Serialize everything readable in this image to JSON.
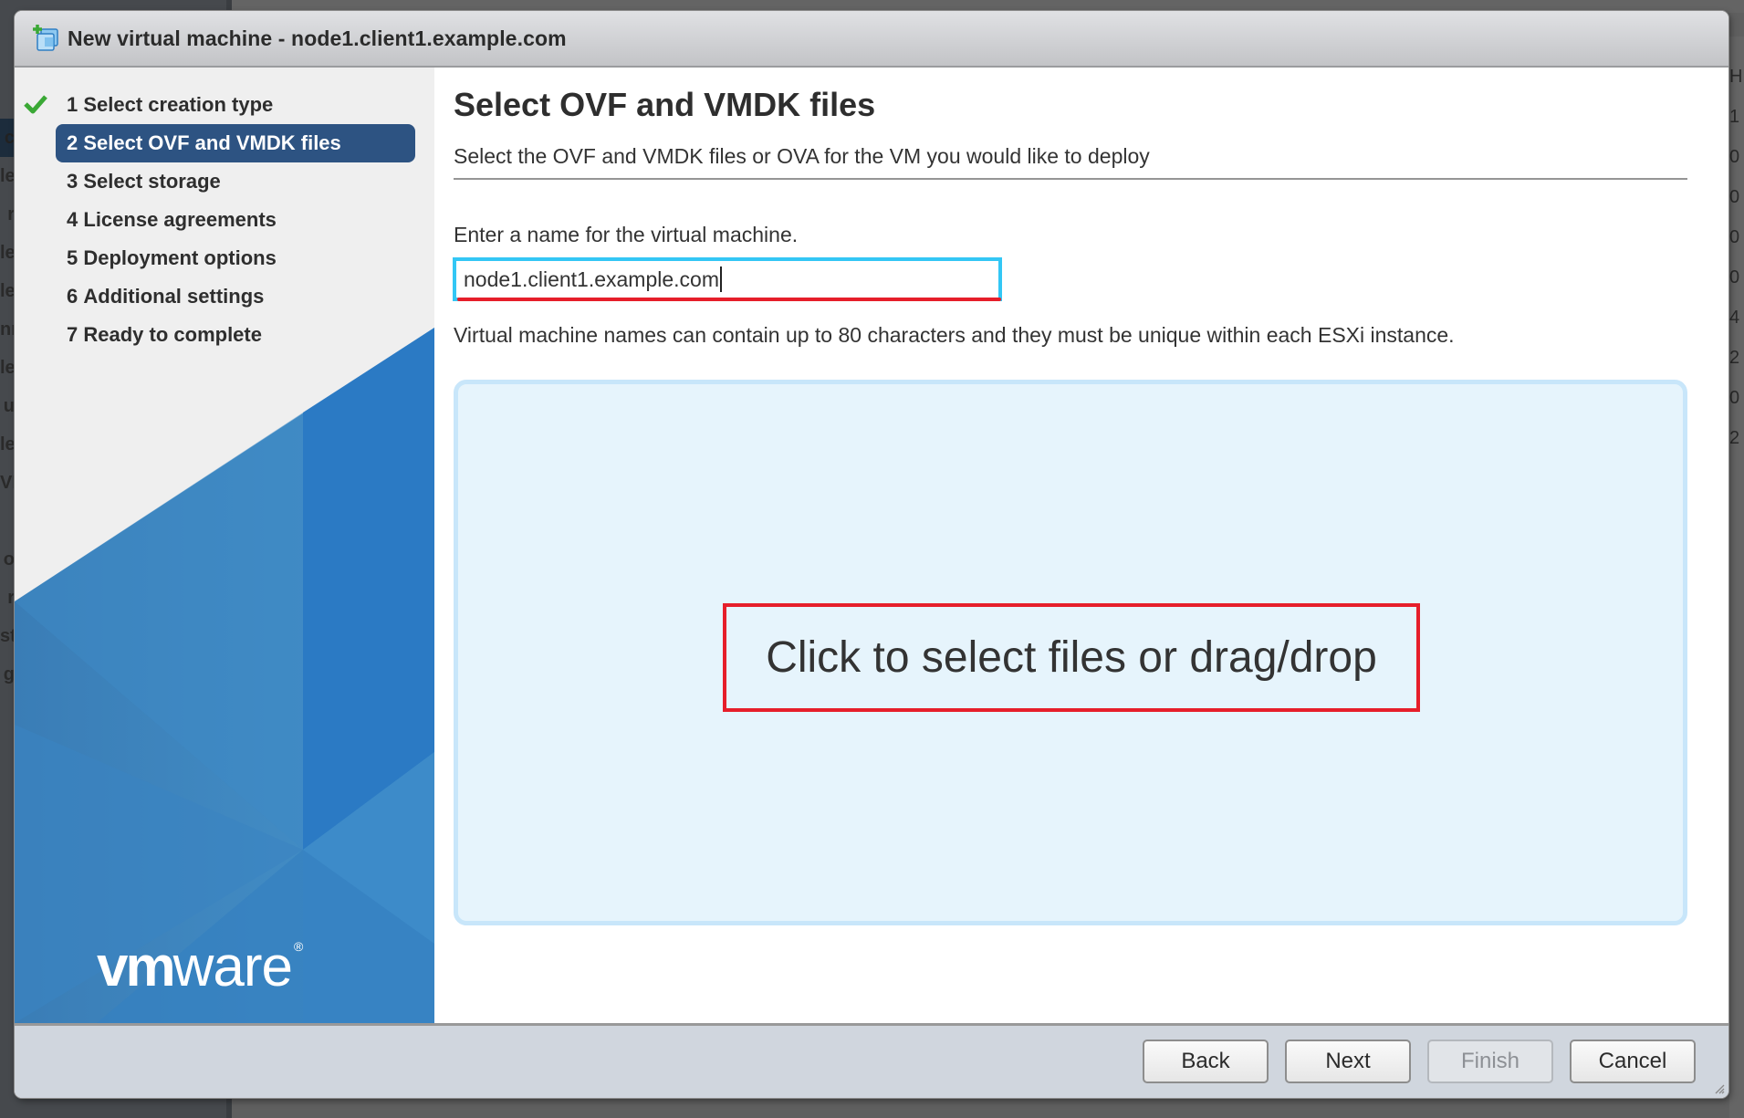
{
  "background": {
    "left_fragments": [
      "c",
      "le",
      "r",
      "le",
      "le",
      "nr",
      "le",
      "u",
      "le",
      "VI",
      "",
      "o",
      "r",
      "st",
      "g"
    ],
    "right_fragments": [
      "H",
      "1",
      "0",
      "0",
      "0",
      "0",
      "4",
      "2",
      "0",
      "2"
    ]
  },
  "dialog": {
    "title": "New virtual machine - node1.client1.example.com",
    "title_icon": "new-vm-icon"
  },
  "wizard": {
    "steps": [
      {
        "number": "1",
        "label": "Select creation type",
        "state": "completed"
      },
      {
        "number": "2",
        "label": "Select OVF and VMDK files",
        "state": "active"
      },
      {
        "number": "3",
        "label": "Select storage",
        "state": "pending"
      },
      {
        "number": "4",
        "label": "License agreements",
        "state": "pending"
      },
      {
        "number": "5",
        "label": "Deployment options",
        "state": "pending"
      },
      {
        "number": "6",
        "label": "Additional settings",
        "state": "pending"
      },
      {
        "number": "7",
        "label": "Ready to complete",
        "state": "pending"
      }
    ],
    "logo_text": {
      "bold": "vm",
      "regular": "ware",
      "mark": "®"
    }
  },
  "page": {
    "title": "Select OVF and VMDK files",
    "subtitle": "Select the OVF and VMDK files or OVA for the VM you would like to deploy",
    "name_label": "Enter a name for the virtual machine.",
    "name_value": "node1.client1.example.com",
    "help_text": "Virtual machine names can contain up to 80 characters and they must be unique within each ESXi instance.",
    "drop_zone_text": "Click to select files or drag/drop"
  },
  "footer": {
    "back_label": "Back",
    "next_label": "Next",
    "finish_label": "Finish",
    "finish_disabled": true,
    "cancel_label": "Cancel"
  },
  "colors": {
    "active_step": "#2d5382",
    "focus_border": "#33c7f5",
    "highlight_red": "#e61e2a",
    "check_green": "#3aa835",
    "drop_zone_bg": "#e6f4fc"
  }
}
